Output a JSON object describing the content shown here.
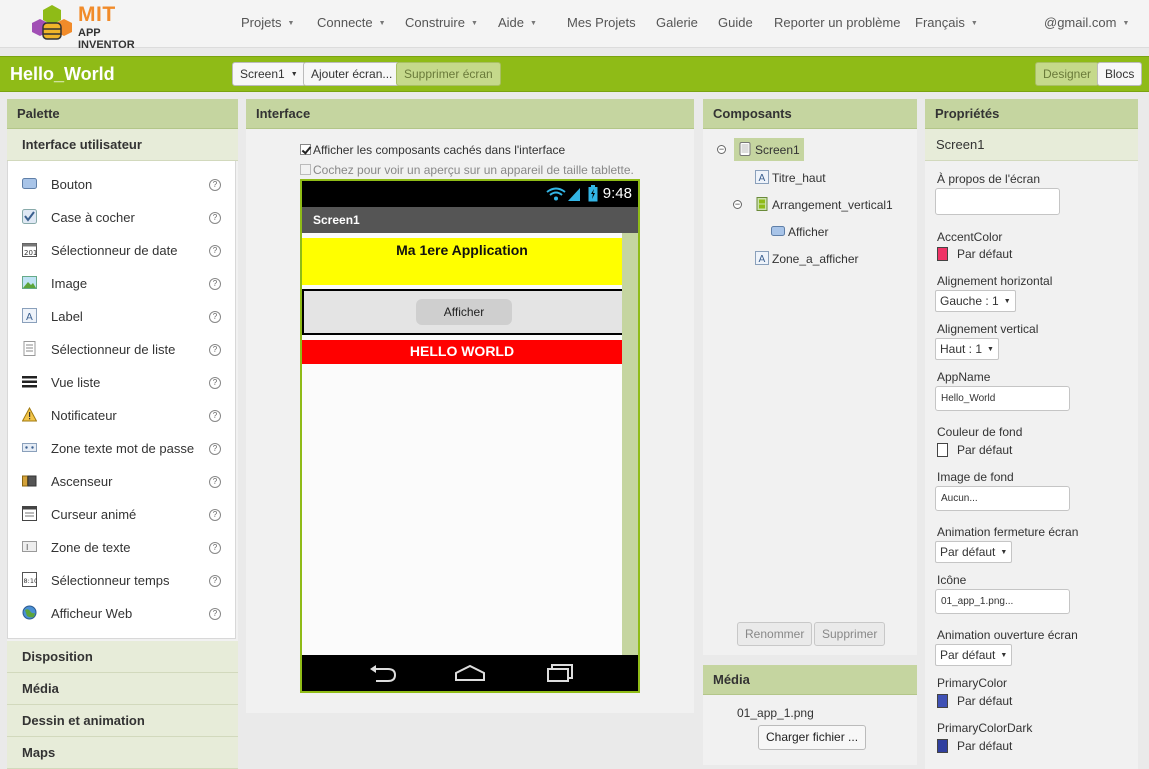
{
  "brand": {
    "mit": "MIT",
    "app_inventor": "APP INVENTOR"
  },
  "topnav": {
    "menus": [
      {
        "label": "Projets",
        "dropdown": true
      },
      {
        "label": "Connecte",
        "dropdown": true
      },
      {
        "label": "Construire",
        "dropdown": true
      },
      {
        "label": "Aide",
        "dropdown": true
      },
      {
        "label": "Mes Projets",
        "dropdown": false
      },
      {
        "label": "Galerie",
        "dropdown": false
      },
      {
        "label": "Guide",
        "dropdown": false
      },
      {
        "label": "Reporter un problème",
        "dropdown": false
      },
      {
        "label": "Français",
        "dropdown": true
      },
      {
        "label": "@gmail.com",
        "dropdown": true
      }
    ]
  },
  "projectbar": {
    "title": "Hello_World",
    "screen_select": "Screen1",
    "add_screen": "Ajouter écran...",
    "remove_screen": "Supprimer écran",
    "designer": "Designer",
    "blocks": "Blocs"
  },
  "palette": {
    "title": "Palette",
    "category": "Interface utilisateur",
    "items": [
      {
        "label": "Bouton",
        "icon": "button-icon"
      },
      {
        "label": "Case à cocher",
        "icon": "checkbox-icon"
      },
      {
        "label": "Sélectionneur de date",
        "icon": "datepicker-icon"
      },
      {
        "label": "Image",
        "icon": "image-icon"
      },
      {
        "label": "Label",
        "icon": "label-icon"
      },
      {
        "label": "Sélectionneur de liste",
        "icon": "listpicker-icon"
      },
      {
        "label": "Vue liste",
        "icon": "listview-icon"
      },
      {
        "label": "Notificateur",
        "icon": "notifier-icon"
      },
      {
        "label": "Zone texte mot de passe",
        "icon": "password-icon"
      },
      {
        "label": "Ascenseur",
        "icon": "slider-icon"
      },
      {
        "label": "Curseur animé",
        "icon": "spinner-icon"
      },
      {
        "label": "Zone de texte",
        "icon": "textbox-icon"
      },
      {
        "label": "Sélectionneur temps",
        "icon": "timepicker-icon"
      },
      {
        "label": "Afficheur Web",
        "icon": "webviewer-icon"
      }
    ],
    "help_glyph": "?",
    "categories": [
      "Disposition",
      "Média",
      "Dessin et animation",
      "Maps"
    ]
  },
  "interface": {
    "title": "Interface",
    "show_hidden": "Afficher les composants cachés dans l'interface",
    "tablet_preview": "Cochez pour voir un aperçu sur un appareil de taille tablette.",
    "phone": {
      "time": "9:48",
      "screen_title": "Screen1",
      "titre_haut": "Ma 1ere Application",
      "button": "Afficher",
      "zone": "HELLO WORLD",
      "colors": {
        "titre_bg": "#ffff00",
        "zone_bg": "#ff0000"
      }
    }
  },
  "components": {
    "title": "Composants",
    "tree": [
      {
        "label": "Screen1",
        "icon": "screen-icon"
      },
      {
        "label": "Titre_haut",
        "icon": "label-icon"
      },
      {
        "label": "Arrangement_vertical1",
        "icon": "vertical-arrangement-icon"
      },
      {
        "label": "Afficher",
        "icon": "button-icon"
      },
      {
        "label": "Zone_a_afficher",
        "icon": "label-icon"
      }
    ],
    "rename": "Renommer",
    "delete": "Supprimer"
  },
  "media": {
    "title": "Média",
    "file": "01_app_1.png",
    "upload": "Charger fichier ..."
  },
  "properties": {
    "title": "Propriétés",
    "component": "Screen1",
    "about_label": "À propos de l'écran",
    "about_value": "",
    "accent_label": "AccentColor",
    "accent_value": "Par défaut",
    "accent_color": "#ee3366",
    "align_h_label": "Alignement horizontal",
    "align_h_value": "Gauche : 1",
    "align_v_label": "Alignement vertical",
    "align_v_value": "Haut : 1",
    "appname_label": "AppName",
    "appname_value": "Hello_World",
    "bgcolor_label": "Couleur de fond",
    "bgcolor_value": "Par défaut",
    "bgcolor_color": "#ffffff",
    "bgimage_label": "Image de fond",
    "bgimage_value": "Aucun...",
    "close_anim_label": "Animation fermeture écran",
    "close_anim_value": "Par défaut",
    "icon_label": "Icône",
    "icon_value": "01_app_1.png...",
    "open_anim_label": "Animation ouverture écran",
    "open_anim_value": "Par défaut",
    "primary_label": "PrimaryColor",
    "primary_value": "Par défaut",
    "primary_color": "#3f51b5",
    "primary_dark_label": "PrimaryColorDark",
    "primary_dark_value": "Par défaut",
    "primary_dark_color": "#303f9f"
  }
}
